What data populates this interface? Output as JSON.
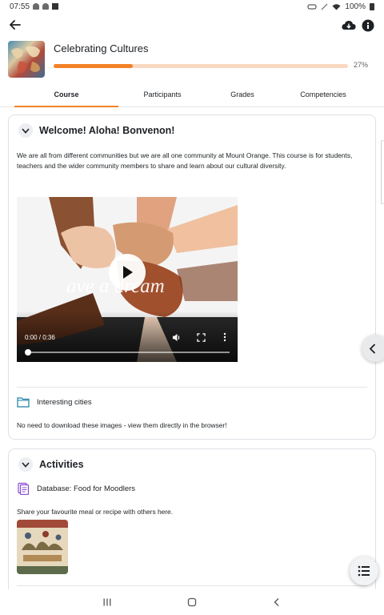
{
  "status_bar": {
    "time": "07:55",
    "battery": "100%"
  },
  "course": {
    "title": "Celebrating Cultures",
    "progress_percent": 27,
    "progress_label": "27%"
  },
  "tabs": [
    {
      "label": "Course",
      "active": true
    },
    {
      "label": "Participants",
      "active": false
    },
    {
      "label": "Grades",
      "active": false
    },
    {
      "label": "Competencies",
      "active": false
    }
  ],
  "section1": {
    "title": "Welcome! Aloha! Bonvenon!",
    "summary": "We are all from different communities but we are all one community at Mount Orange. This course is for students, teachers and the wider community members to share and learn about our cultural diversity.",
    "video": {
      "caption": "ave a dream",
      "time": "0:00 / 0:36",
      "progress_fraction": 0
    },
    "activity": {
      "name": "Interesting cities",
      "icon": "folder-icon",
      "description": "No need to download these images - view them directly in the browser!"
    }
  },
  "section2": {
    "title": "Activities",
    "activity": {
      "name": "Database: Food for Moodlers",
      "icon": "database-icon",
      "description": "Share your favourite meal or recipe with others here."
    }
  },
  "colors": {
    "accent": "#f38226",
    "progress_track": "#fad9c2",
    "text": "#1d2125",
    "border": "#dee2e6"
  }
}
